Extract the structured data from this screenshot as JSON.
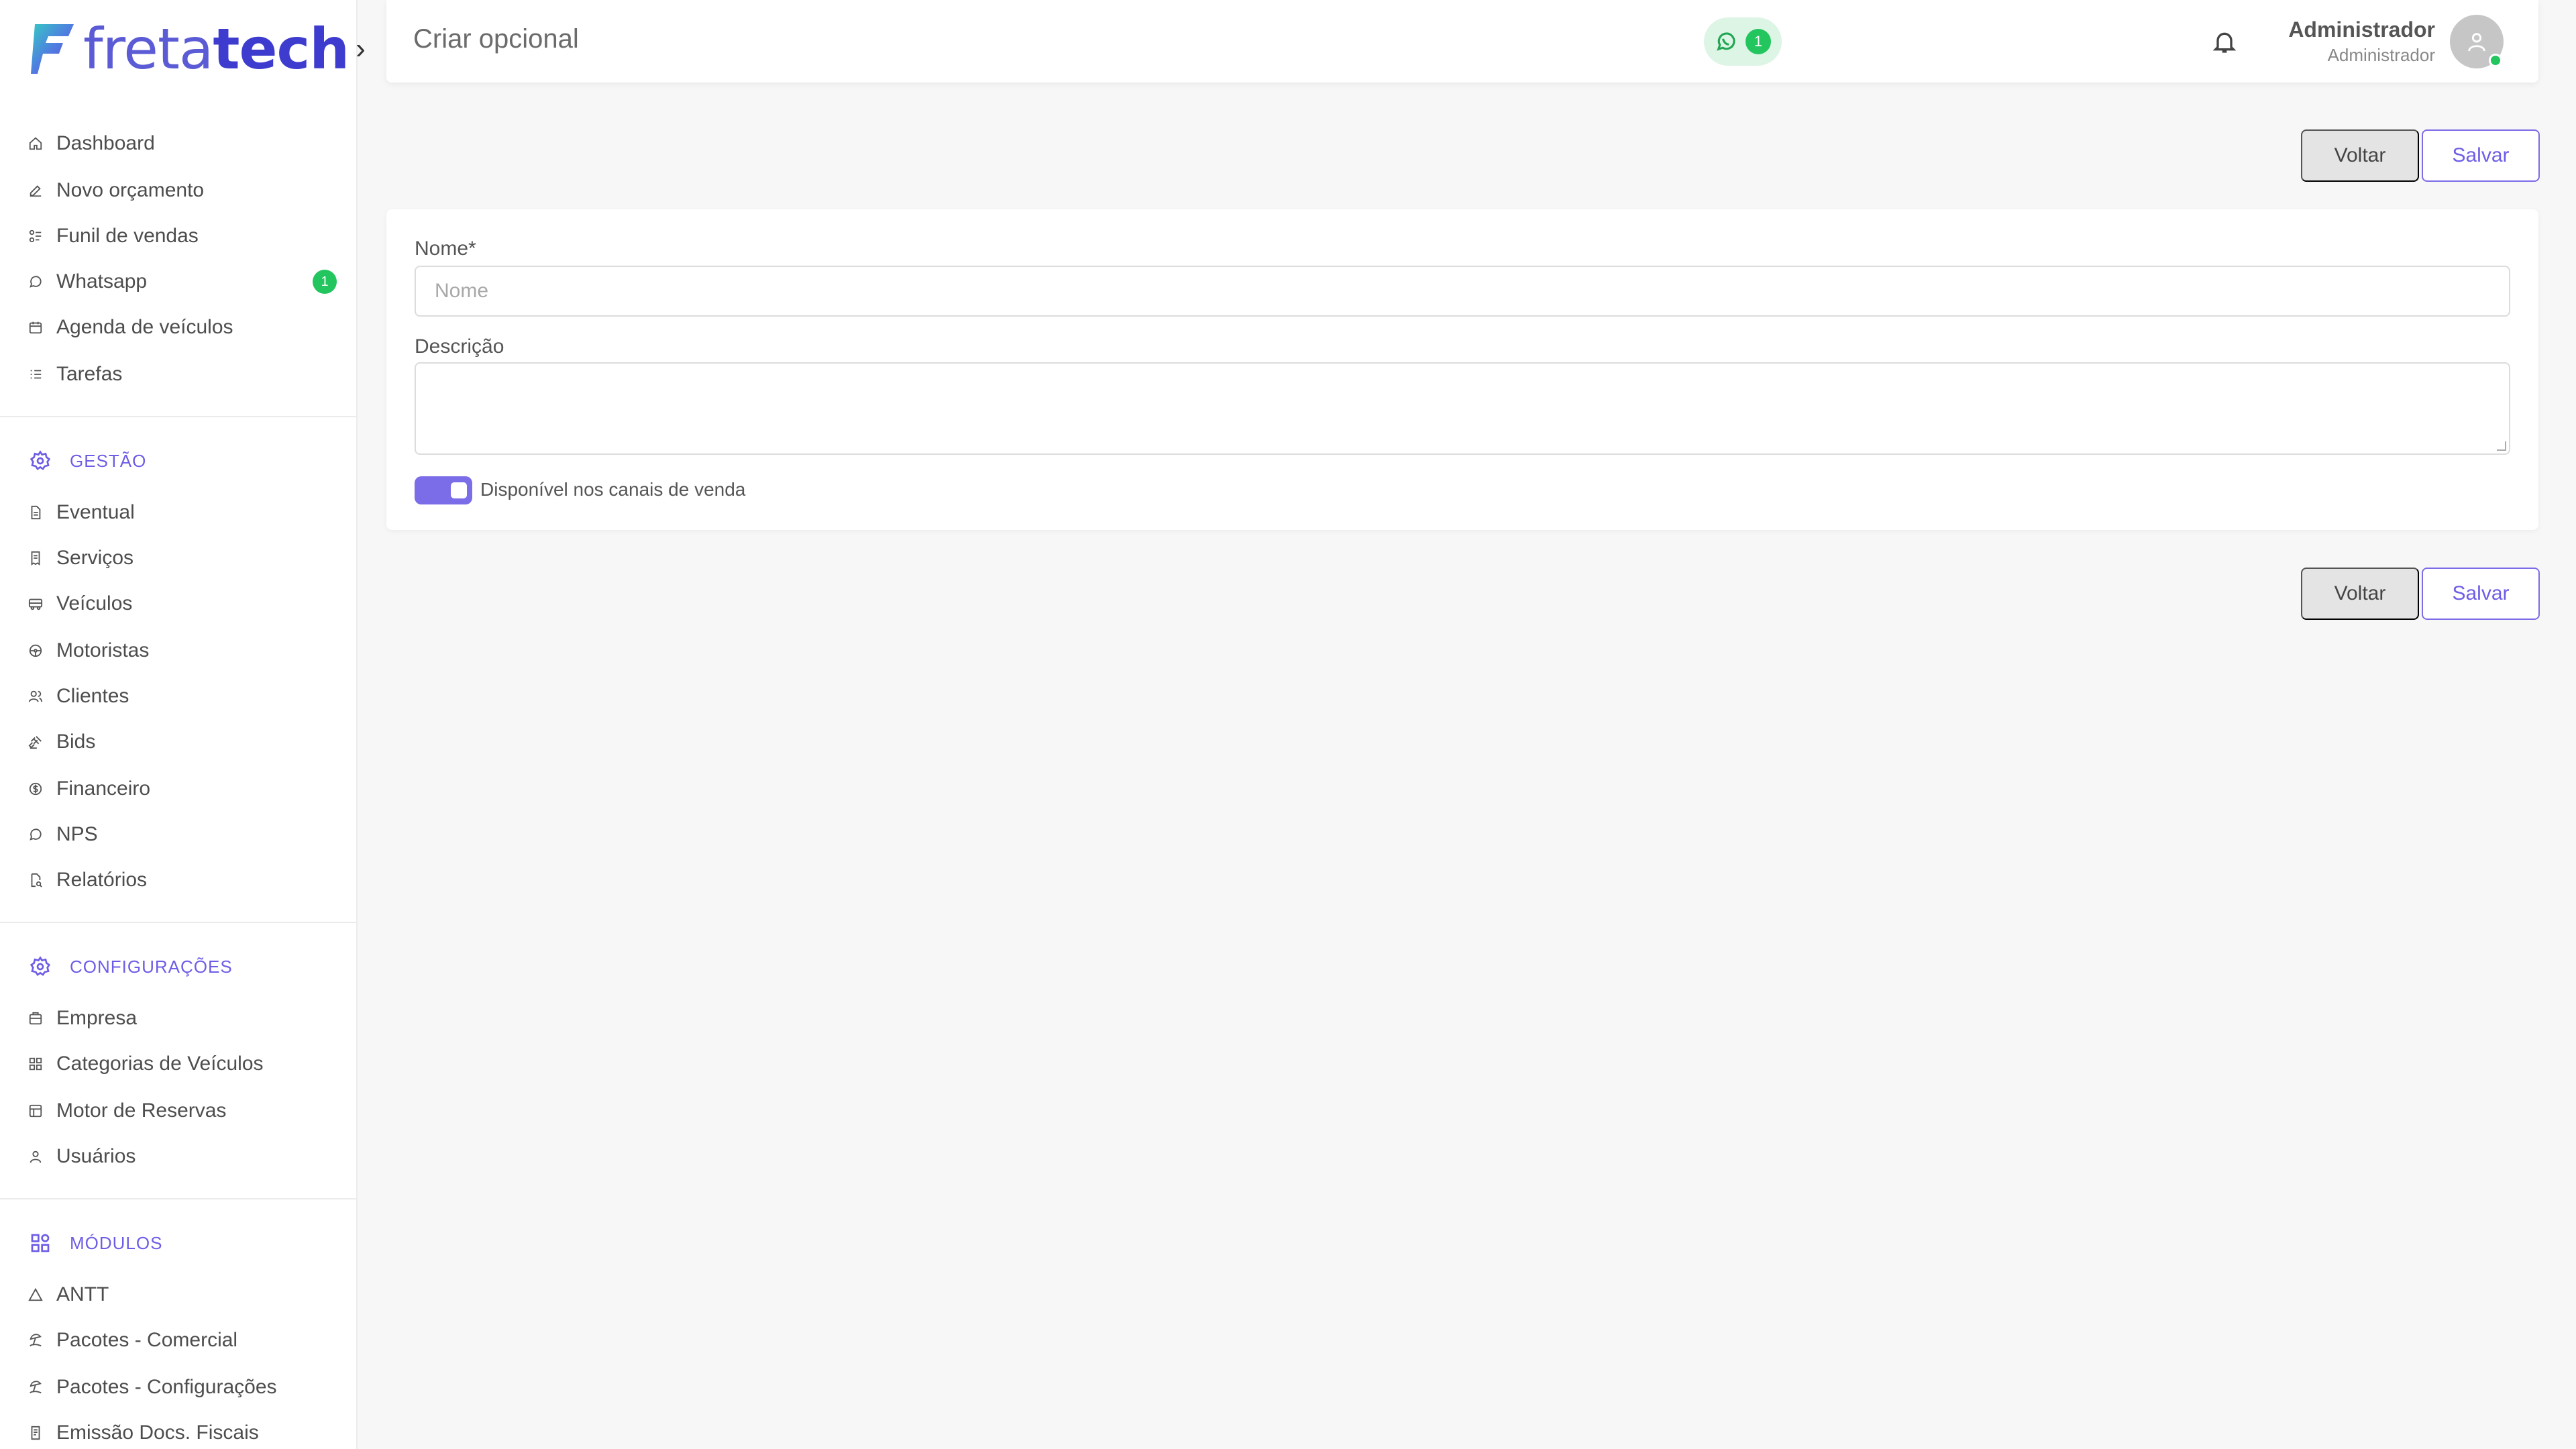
{
  "app": {
    "logo_light": "freta",
    "logo_bold": "tech",
    "logo_chevron": "›"
  },
  "sidebar": {
    "main_items": [
      {
        "label": "Dashboard",
        "icon": "home-icon"
      },
      {
        "label": "Novo orçamento",
        "icon": "edit-icon"
      },
      {
        "label": "Funil de vendas",
        "icon": "funnel-icon"
      },
      {
        "label": "Whatsapp",
        "icon": "whatsapp-icon",
        "badge": "1"
      },
      {
        "label": "Agenda de veículos",
        "icon": "calendar-icon"
      },
      {
        "label": "Tarefas",
        "icon": "list-icon"
      }
    ],
    "gestao": {
      "title": "GESTÃO",
      "items": [
        {
          "label": "Eventual",
          "icon": "document-icon"
        },
        {
          "label": "Serviços",
          "icon": "receipt-icon"
        },
        {
          "label": "Veículos",
          "icon": "bus-icon"
        },
        {
          "label": "Motoristas",
          "icon": "steering-wheel-icon"
        },
        {
          "label": "Clientes",
          "icon": "users-icon"
        },
        {
          "label": "Bids",
          "icon": "gavel-icon"
        },
        {
          "label": "Financeiro",
          "icon": "coin-icon"
        },
        {
          "label": "NPS",
          "icon": "chat-icon"
        },
        {
          "label": "Relatórios",
          "icon": "report-icon"
        }
      ]
    },
    "configuracoes": {
      "title": "CONFIGURAÇÕES",
      "items": [
        {
          "label": "Empresa",
          "icon": "building-icon"
        },
        {
          "label": "Categorias de Veículos",
          "icon": "grid-icon"
        },
        {
          "label": "Motor de Reservas",
          "icon": "table-icon"
        },
        {
          "label": "Usuários",
          "icon": "user-icon"
        }
      ]
    },
    "modulos": {
      "title": "MÓDULOS",
      "items": [
        {
          "label": "ANTT",
          "icon": "triangle-icon"
        },
        {
          "label": "Pacotes - Comercial",
          "icon": "beach-icon"
        },
        {
          "label": "Pacotes - Configurações",
          "icon": "beach-icon"
        },
        {
          "label": "Emissão Docs. Fiscais",
          "icon": "fiscal-doc-icon"
        }
      ]
    }
  },
  "header": {
    "title": "Criar opcional",
    "whatsapp_count": "1",
    "user_name": "Administrador",
    "user_role": "Administrador"
  },
  "actions": {
    "back_label": "Voltar",
    "save_label": "Salvar"
  },
  "form": {
    "name_label": "Nome*",
    "name_placeholder": "Nome",
    "name_value": "",
    "description_label": "Descrição",
    "description_value": "",
    "toggle_label": "Disponível nos canais de venda",
    "toggle_on": true
  },
  "colors": {
    "accent": "#6d5de6",
    "success": "#22c55e",
    "background": "#f7f7f8"
  }
}
